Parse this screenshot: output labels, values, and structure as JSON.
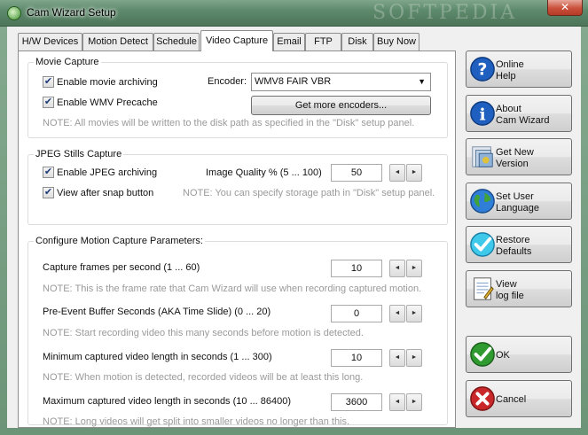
{
  "window": {
    "title": "Cam Wizard Setup",
    "watermark": "SOFTPEDIA",
    "close_glyph": "✕"
  },
  "tabs": [
    {
      "label": "H/W Devices"
    },
    {
      "label": "Motion Detect"
    },
    {
      "label": "Schedule"
    },
    {
      "label": "Video Capture",
      "active": true
    },
    {
      "label": "Email"
    },
    {
      "label": "FTP"
    },
    {
      "label": "Disk"
    },
    {
      "label": "Buy Now"
    }
  ],
  "movie_capture": {
    "title": "Movie Capture",
    "enable_archiving": {
      "label": "Enable movie archiving",
      "checked": true
    },
    "enable_precache": {
      "label": "Enable WMV Precache",
      "checked": true
    },
    "encoder_label": "Encoder:",
    "encoder_value": "WMV8 FAIR VBR",
    "more_encoders_button": "Get more encoders...",
    "note": "NOTE: All movies will be written to the disk path as specified in the \"Disk\" setup panel."
  },
  "jpeg_capture": {
    "title": "JPEG Stills Capture",
    "enable_jpeg": {
      "label": "Enable JPEG archiving",
      "checked": true
    },
    "view_after_snap": {
      "label": "View after snap button",
      "checked": true
    },
    "quality_label": "Image Quality % (5 ... 100)",
    "quality_value": "50",
    "note": "NOTE: You can specify storage path in \"Disk\" setup panel."
  },
  "motion_params": {
    "title": "Configure Motion Capture Parameters:",
    "fps": {
      "label": "Capture frames per second (1 ... 60)",
      "value": "10",
      "note": "NOTE: This is the frame rate that Cam Wizard will use when recording captured motion."
    },
    "pre_event": {
      "label": "Pre-Event Buffer Seconds (AKA Time Slide) (0 ... 20)",
      "value": "0",
      "note": "NOTE: Start recording video this many seconds before motion is detected."
    },
    "min_length": {
      "label": "Minimum captured video length in seconds (1 ... 300)",
      "value": "10",
      "note": "NOTE: When motion is detected, recorded videos will be at least this long."
    },
    "max_length": {
      "label": "Maximum captured video length in seconds (10 ... 86400)",
      "value": "3600",
      "note": "NOTE: Long videos will get split into smaller videos no longer than this."
    }
  },
  "spin_glyphs": {
    "left": "◄",
    "right": "►"
  },
  "checkmark": "✔",
  "side_buttons": {
    "online_help": {
      "label": "Online\nHelp",
      "icon": "question-icon"
    },
    "about": {
      "label": "About\nCam Wizard",
      "icon": "info-icon"
    },
    "new_version": {
      "label": "Get New\nVersion",
      "icon": "download-box-icon"
    },
    "language": {
      "label": "Set User\nLanguage",
      "icon": "globe-icon"
    },
    "restore": {
      "label": "Restore\nDefaults",
      "icon": "checkmark-icon"
    },
    "view_log": {
      "label": "View\nlog file",
      "icon": "notepad-icon"
    },
    "ok": {
      "label": "OK",
      "icon": "ok-check-icon"
    },
    "cancel": {
      "label": "Cancel",
      "icon": "cancel-x-icon"
    }
  },
  "colors": {
    "frame_green": "#6c9477",
    "note_gray": "#9a9a9a",
    "help_blue": "#1f5fbf",
    "ok_green": "#2f9a2f",
    "cancel_red": "#c8282a"
  }
}
